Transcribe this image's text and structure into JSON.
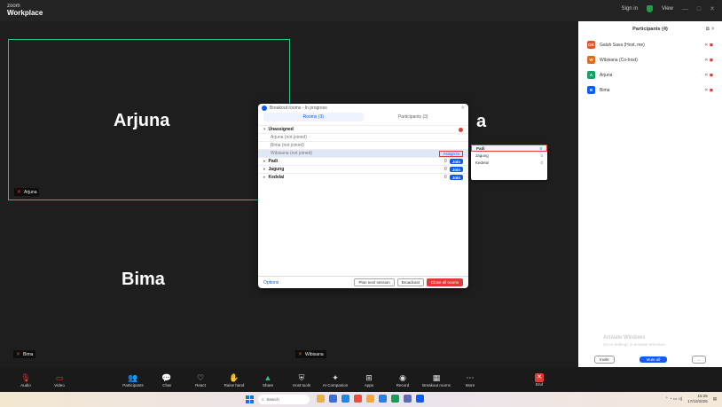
{
  "title_bar": {
    "brand_small": "zoom",
    "brand_large": "Workplace",
    "sign_in": "Sign in",
    "view": "View"
  },
  "tiles": {
    "arjuna": "Arjuna",
    "bima": "Bima",
    "wibisana_tag": "Wibisana",
    "arjuna_tag": "Arjuna",
    "bima_tag": "Bima",
    "right_partial": "a"
  },
  "dialog": {
    "title": "Breakout rooms - In progress",
    "tab_rooms": "Rooms (3)",
    "tab_participants": "Participants (3)",
    "rows": [
      {
        "label": "Unassigned",
        "kind": "group"
      },
      {
        "label": "Arjuna (not joined)",
        "kind": "member"
      },
      {
        "label": "Bima (not joined)",
        "kind": "member"
      },
      {
        "label": "Wibisana (not joined)",
        "kind": "member"
      },
      {
        "label": "Padi",
        "kind": "room",
        "count": "0",
        "join": "Join"
      },
      {
        "label": "Jagung",
        "kind": "room",
        "count": "0",
        "join": "Join"
      },
      {
        "label": "Kedelai",
        "kind": "room",
        "count": "0",
        "join": "Join"
      }
    ],
    "assign_to": "Assign to",
    "options": "Options",
    "plan_next": "Plan next session",
    "broadcast": "Broadcast",
    "close_all": "Close all rooms"
  },
  "dropdown": {
    "items": [
      {
        "label": "Padi",
        "count": "0"
      },
      {
        "label": "Jagung",
        "count": "0"
      },
      {
        "label": "Kedelai",
        "count": "0"
      }
    ]
  },
  "panel": {
    "title": "Participants (4)",
    "people": [
      {
        "initials": "GK",
        "name": "Galuh Sava (Host, me)",
        "color": "#e0562b"
      },
      {
        "initials": "W",
        "name": "Wibisana (Co-host)",
        "color": "#e06b1f"
      },
      {
        "initials": "A",
        "name": "Arjuna",
        "color": "#16a06a"
      },
      {
        "initials": "B",
        "name": "Bima",
        "color": "#0b5cff"
      }
    ],
    "activate_line1": "Activate Windows",
    "activate_line2": "Go to Settings to activate Windows.",
    "invite": "Invite",
    "mute_all": "Mute all",
    "more": "..."
  },
  "toolbar": {
    "audio": "Audio",
    "video": "Video",
    "participants": "Participants",
    "participants_count": "4",
    "chat": "Chat",
    "react": "React",
    "raise_hand": "Raise hand",
    "share": "Share",
    "host_tools": "Host tools",
    "ai_companion": "AI Companion",
    "apps": "Apps",
    "record": "Record",
    "breakout_rooms": "Breakout rooms",
    "more": "More",
    "end": "End"
  },
  "taskbar": {
    "search": "Search",
    "time": "15:26",
    "date": "17/10/2025"
  }
}
